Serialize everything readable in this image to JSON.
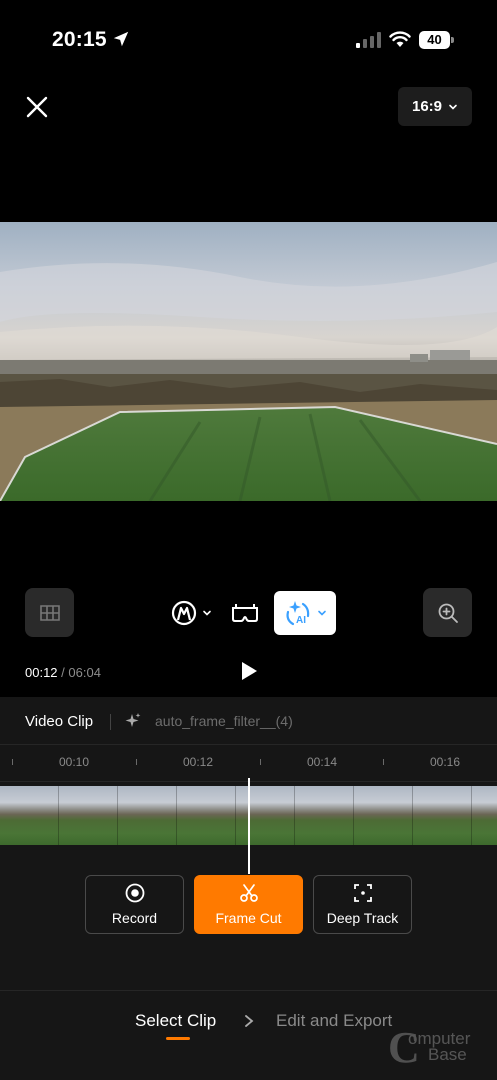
{
  "status_bar": {
    "time": "20:15",
    "battery": "40"
  },
  "top_bar": {
    "aspect_ratio": "16:9"
  },
  "playback": {
    "current_time": "00:12",
    "separator": "/",
    "total_time": "06:04"
  },
  "clip_header": {
    "label": "Video Clip",
    "filter": "auto_frame_filter__(4)"
  },
  "ruler": {
    "ticks": [
      "00:10",
      "00:12",
      "00:14",
      "00:16"
    ]
  },
  "actions": {
    "record": "Record",
    "frame_cut": "Frame Cut",
    "deep_track": "Deep Track"
  },
  "steps": {
    "step1": "Select Clip",
    "step2": "Edit and Export"
  },
  "ai_button": {
    "label": "AI"
  },
  "watermark": {
    "letter": "C",
    "line1": "omputer",
    "line2": "Base"
  },
  "colors": {
    "accent": "#ff7a00",
    "ai_blue": "#3aa0ff"
  }
}
